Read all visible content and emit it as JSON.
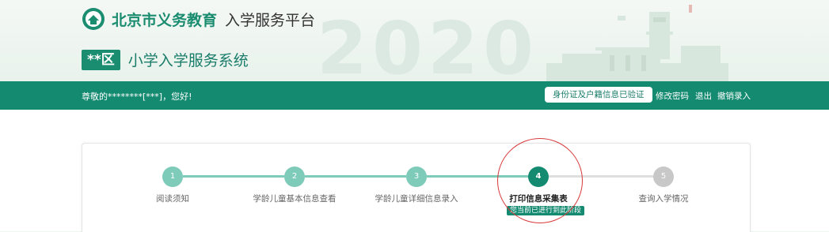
{
  "header": {
    "brand": "北京市义务教育",
    "brand_sub": "入学服务平台",
    "watermark": "2020",
    "district": "**区",
    "system_title": "小学入学服务系统"
  },
  "bar": {
    "greeting": "尊敬的********[***]，您好!",
    "verify_badge": "身份证及户籍信息已验证",
    "links": [
      "修改密码",
      "退出",
      "撤销录入"
    ]
  },
  "steps": [
    {
      "num": "1",
      "label": "阅读须知",
      "state": "done"
    },
    {
      "num": "2",
      "label": "学龄儿童基本信息查看",
      "state": "done"
    },
    {
      "num": "3",
      "label": "学龄儿童详细信息录入",
      "state": "done"
    },
    {
      "num": "4",
      "label": "打印信息采集表",
      "state": "current"
    },
    {
      "num": "5",
      "label": "查询入学情况",
      "state": "pending"
    }
  ],
  "current_status": "您当前已进行到此阶段",
  "colors": {
    "primary": "#148a70",
    "done": "#7ecbb9",
    "pending": "#c8c8c8",
    "highlight": "#d83a3a"
  }
}
